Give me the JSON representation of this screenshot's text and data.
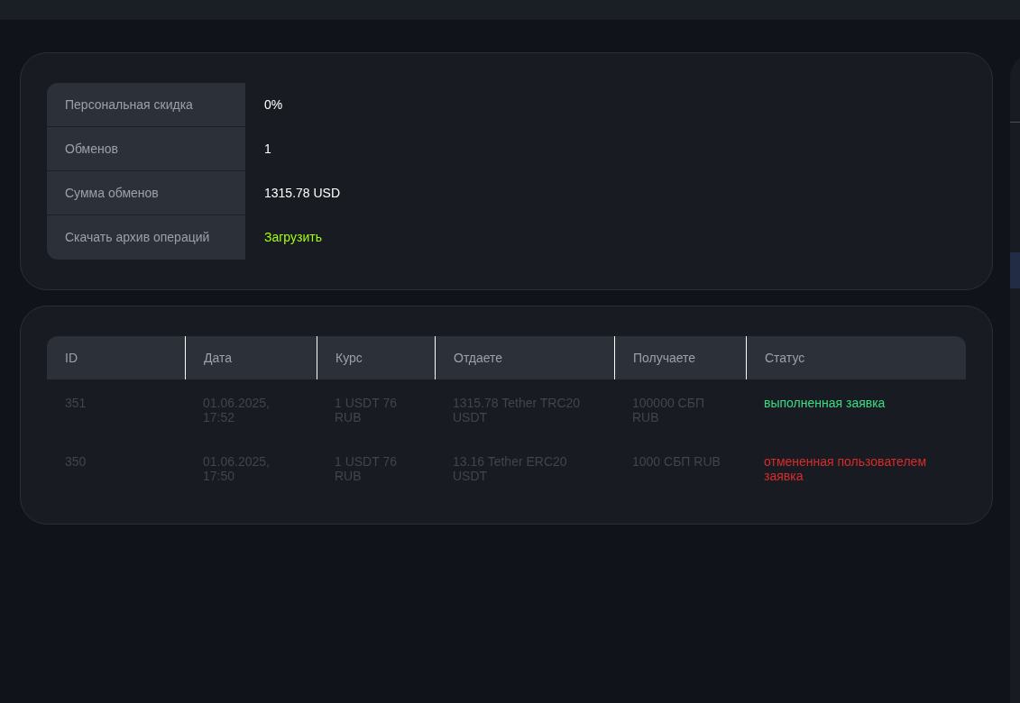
{
  "info": [
    {
      "label": "Персональная скидка",
      "value": "0%",
      "kind": "text"
    },
    {
      "label": "Обменов",
      "value": "1",
      "kind": "text"
    },
    {
      "label": "Сумма обменов",
      "value": "1315.78 USD",
      "kind": "text"
    },
    {
      "label": "Скачать архив операций",
      "value": "Загрузить",
      "kind": "link"
    }
  ],
  "table": {
    "columns": [
      "ID",
      "Дата",
      "Курс",
      "Отдаете",
      "Получаете",
      "Статус"
    ],
    "rows": [
      {
        "cells": [
          "351",
          "01.06.2025, 17:52",
          "1 USDT 76 RUB",
          "1315.78 Tether TRC20 USDT",
          "100000 СБП RUB"
        ],
        "status": "выполненная заявка",
        "color": "#3ddc84"
      },
      {
        "cells": [
          "350",
          "01.06.2025, 17:50",
          "1 USDT 76 RUB",
          "13.16 Tether ERC20 USDT",
          "1000 СБП RUB"
        ],
        "status": "отмененная пользователем заявка",
        "color": "#d92b2b"
      }
    ]
  }
}
